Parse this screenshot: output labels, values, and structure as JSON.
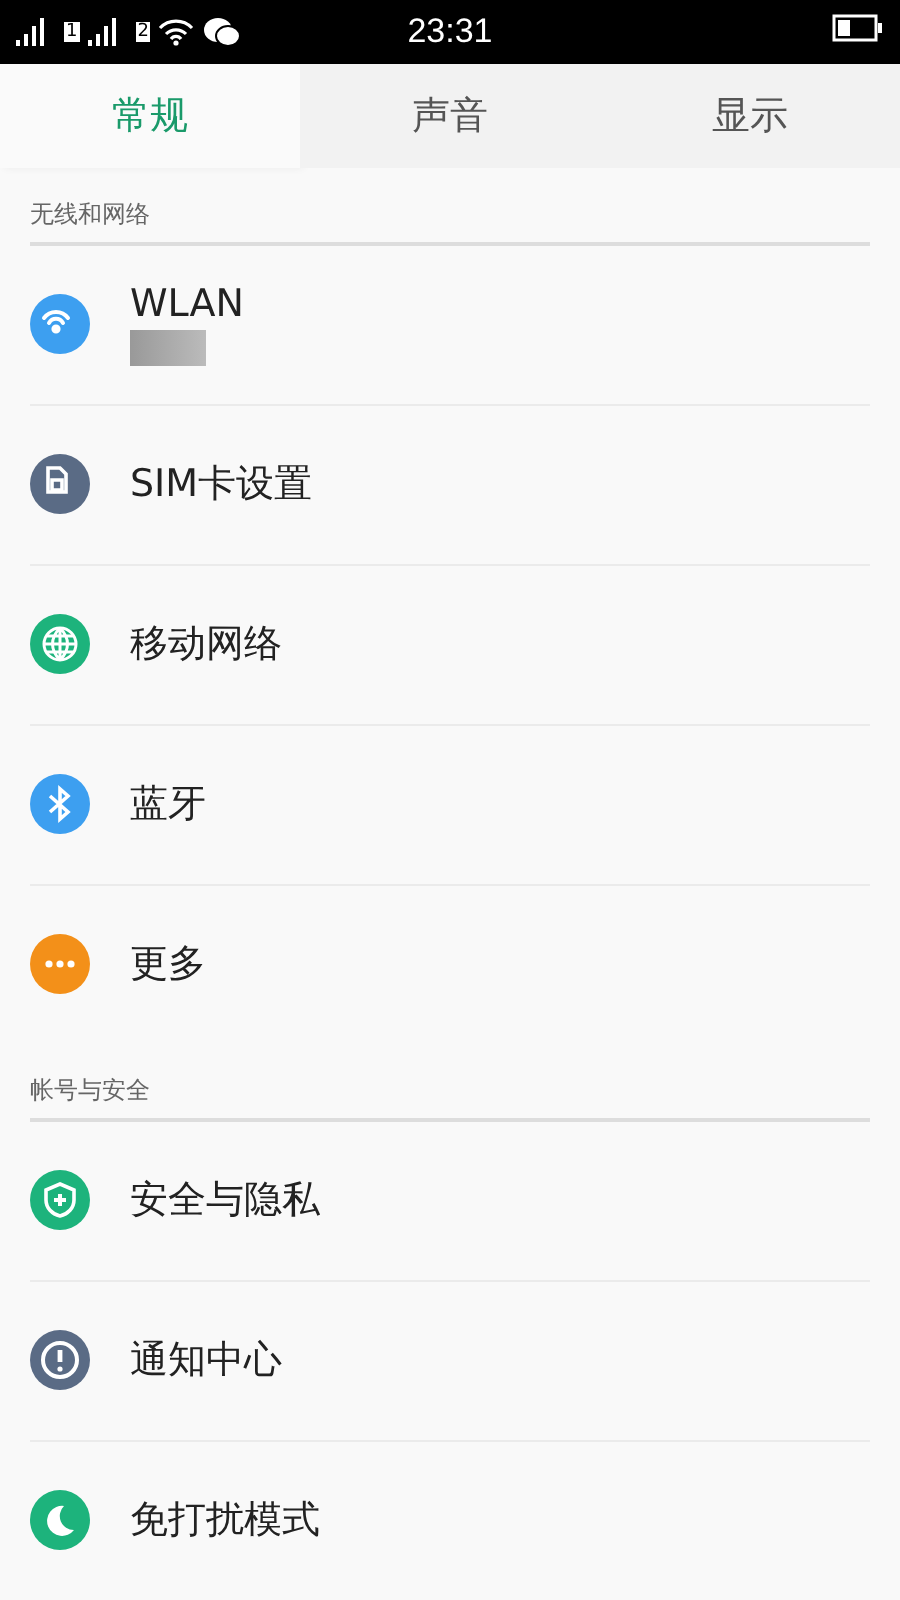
{
  "status_bar": {
    "time": "23:31",
    "sim_slots": [
      "1",
      "2"
    ]
  },
  "tabs": [
    {
      "label": "常规",
      "selected": true
    },
    {
      "label": "声音",
      "selected": false
    },
    {
      "label": "显示",
      "selected": false
    }
  ],
  "sections": [
    {
      "title": "无线和网络",
      "items": [
        {
          "kind": "wifi",
          "color": "#3d9ff0",
          "label": "WLAN",
          "redacted_subtitle": true
        },
        {
          "kind": "sim",
          "color": "#5a6b85",
          "label": "SIM卡设置"
        },
        {
          "kind": "globe",
          "color": "#1db37c",
          "label": "移动网络"
        },
        {
          "kind": "bluetooth",
          "color": "#3d9ff0",
          "label": "蓝牙"
        },
        {
          "kind": "more",
          "color": "#f39019",
          "label": "更多"
        }
      ]
    },
    {
      "title": "帐号与安全",
      "items": [
        {
          "kind": "shield",
          "color": "#1db37c",
          "label": "安全与隐私"
        },
        {
          "kind": "alert",
          "color": "#5a6b85",
          "label": "通知中心"
        },
        {
          "kind": "moon",
          "color": "#1db37c",
          "label": "免打扰模式"
        }
      ]
    }
  ]
}
